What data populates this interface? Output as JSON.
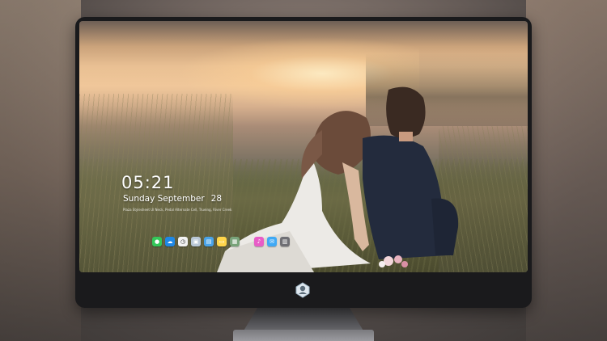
{
  "lock_screen": {
    "time": "05:21",
    "date_weekday_month": "Sunday September",
    "date_day": "28",
    "subtitle": "Plaza Stylesheet Ul Neck, Pedal Alternate Cell, Trueing, River Creek"
  },
  "dock": {
    "items": [
      {
        "name": "messages-icon",
        "color": "#34c759",
        "glyph": "●"
      },
      {
        "name": "weather-icon",
        "color": "#1e88e5",
        "glyph": "☁"
      },
      {
        "name": "clock-icon",
        "color": "#f2f2f2",
        "glyph": "◷"
      },
      {
        "name": "preview-icon",
        "color": "#b9c7d6",
        "glyph": "▣"
      },
      {
        "name": "clapper-icon",
        "color": "#4aa3e8",
        "glyph": "▤"
      },
      {
        "name": "notes-icon",
        "color": "#ffd54a",
        "glyph": "▭"
      },
      {
        "name": "photos-gallery-icon",
        "color": "#78a37a",
        "glyph": "▦"
      },
      {
        "name": "music-icon",
        "color": "#e85cc7",
        "glyph": "♪"
      },
      {
        "name": "mail-icon",
        "color": "#3fa9f5",
        "glyph": "✉"
      },
      {
        "name": "trash-icon",
        "color": "#6f6f74",
        "glyph": "▥"
      }
    ]
  },
  "colors": {
    "monitor_bezel": "#1a1a1c",
    "lock_text": "#ffffff"
  }
}
